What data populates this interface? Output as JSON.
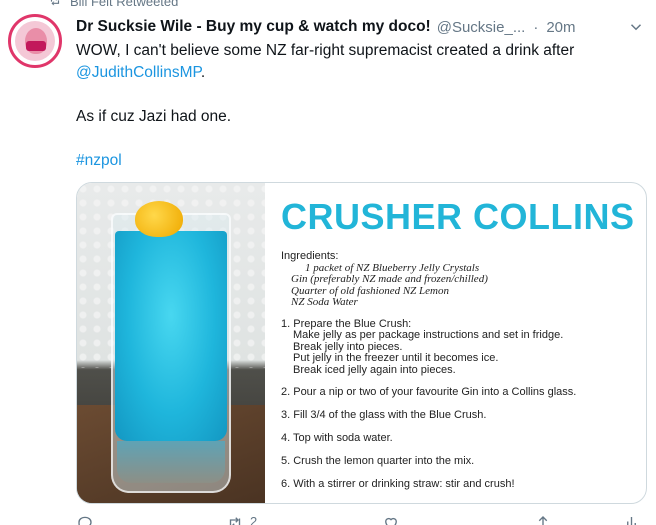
{
  "retweet": {
    "text": "Bill Felt Retweeted"
  },
  "tweet": {
    "display_name": "Dr Sucksie Wile - Buy my cup & watch my doco!",
    "handle": "@Sucksie_...",
    "separator": "·",
    "time": "20m",
    "text_line1": "WOW, I can't believe some NZ far-right supremacist created a drink after",
    "mention": "@JudithCollinsMP",
    "mention_suffix": ".",
    "text_line2": "As if cuz Jazi had one.",
    "hashtag": "#nzpol"
  },
  "recipe": {
    "title": "CRUSHER COLLINS",
    "ingredients_label": "Ingredients:",
    "ingredients": [
      "1 packet of NZ Blueberry Jelly Crystals",
      "Gin (preferably NZ made and frozen/chilled)",
      "Quarter of old fashioned NZ Lemon",
      "NZ Soda Water"
    ],
    "step1_title": "1. Prepare the Blue Crush:",
    "step1_sub": [
      "Make jelly as per package instructions and set in fridge.",
      "Break jelly into pieces.",
      "Put jelly in the freezer until it becomes ice.",
      "Break iced jelly again into pieces."
    ],
    "steps": [
      "2. Pour a nip or two of your favourite Gin into a Collins glass.",
      "3. Fill 3/4 of the glass with the Blue Crush.",
      "4. Top with soda water.",
      "5. Crush the lemon quarter into the mix.",
      "6. With a stirrer or drinking straw: stir and crush!"
    ]
  },
  "actions": {
    "retweet_count": "2"
  },
  "icons": {
    "retweet": "retweet-icon",
    "more": "more-icon",
    "reply": "reply-icon",
    "like": "like-icon",
    "share": "share-icon",
    "analytics": "analytics-icon"
  },
  "colors": {
    "link": "#1b95e0",
    "recipe_title": "#22b5d8",
    "muted": "#657786"
  }
}
